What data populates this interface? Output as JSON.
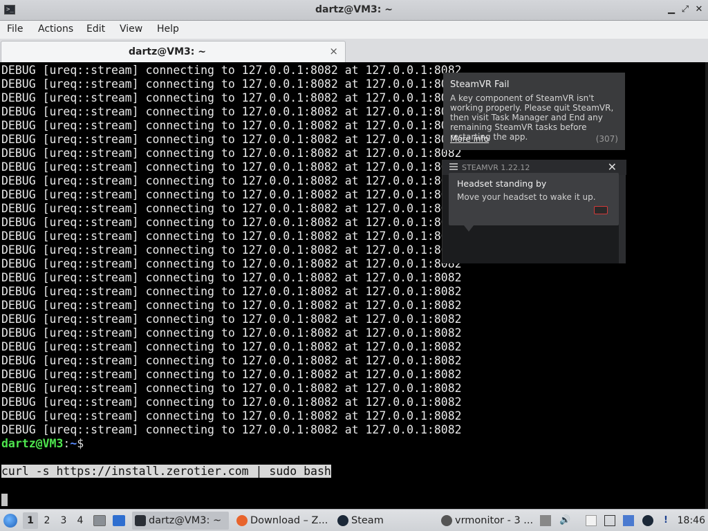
{
  "window": {
    "title": "dartz@VM3: ~",
    "controls": [
      "minimize-icon",
      "maximize-icon",
      "close-icon"
    ]
  },
  "menu": {
    "items": [
      "File",
      "Actions",
      "Edit",
      "View",
      "Help"
    ]
  },
  "tab": {
    "label": "dartz@VM3: ~",
    "close_glyph": "×"
  },
  "terminal": {
    "debug_lines": [
      "DEBUG [ureq::stream] connecting to 127.0.0.1:8082 at 127.0.0.1:8082",
      "DEBUG [ureq::stream] connecting to 127.0.0.1:8082 at 127.0.0.1:8082",
      "DEBUG [ureq::stream] connecting to 127.0.0.1:8082 at 127.0.0.1:8082",
      "DEBUG [ureq::stream] connecting to 127.0.0.1:8082 at 127.0.0.1:8082",
      "DEBUG [ureq::stream] connecting to 127.0.0.1:8082 at 127.0.0.1:8082",
      "DEBUG [ureq::stream] connecting to 127.0.0.1:8082 at 127.0.0.1:8082",
      "DEBUG [ureq::stream] connecting to 127.0.0.1:8082 at 127.0.0.1:8082",
      "DEBUG [ureq::stream] connecting to 127.0.0.1:8082 at 127.0.0.1:8082",
      "DEBUG [ureq::stream] connecting to 127.0.0.1:8082 at 127.0.0.1:8082",
      "DEBUG [ureq::stream] connecting to 127.0.0.1:8082 at 127.0.0.1:8082",
      "DEBUG [ureq::stream] connecting to 127.0.0.1:8082 at 127.0.0.1:8082",
      "DEBUG [ureq::stream] connecting to 127.0.0.1:8082 at 127.0.0.1:8082",
      "DEBUG [ureq::stream] connecting to 127.0.0.1:8082 at 127.0.0.1:8082",
      "DEBUG [ureq::stream] connecting to 127.0.0.1:8082 at 127.0.0.1:8082",
      "DEBUG [ureq::stream] connecting to 127.0.0.1:8082 at 127.0.0.1:8082",
      "DEBUG [ureq::stream] connecting to 127.0.0.1:8082 at 127.0.0.1:8082",
      "DEBUG [ureq::stream] connecting to 127.0.0.1:8082 at 127.0.0.1:8082",
      "DEBUG [ureq::stream] connecting to 127.0.0.1:8082 at 127.0.0.1:8082",
      "DEBUG [ureq::stream] connecting to 127.0.0.1:8082 at 127.0.0.1:8082",
      "DEBUG [ureq::stream] connecting to 127.0.0.1:8082 at 127.0.0.1:8082",
      "DEBUG [ureq::stream] connecting to 127.0.0.1:8082 at 127.0.0.1:8082",
      "DEBUG [ureq::stream] connecting to 127.0.0.1:8082 at 127.0.0.1:8082",
      "DEBUG [ureq::stream] connecting to 127.0.0.1:8082 at 127.0.0.1:8082",
      "DEBUG [ureq::stream] connecting to 127.0.0.1:8082 at 127.0.0.1:8082",
      "DEBUG [ureq::stream] connecting to 127.0.0.1:8082 at 127.0.0.1:8082",
      "DEBUG [ureq::stream] connecting to 127.0.0.1:8082 at 127.0.0.1:8082",
      "DEBUG [ureq::stream] connecting to 127.0.0.1:8082 at 127.0.0.1:8082"
    ],
    "prompt": {
      "user": "dartz@VM3",
      "separator": ":",
      "path": "~",
      "symbol": "$"
    },
    "selected_command": "curl -s https://install.zerotier.com | sudo bash"
  },
  "steamvr_notification": {
    "title": "SteamVR Fail",
    "body": "A key component of SteamVR isn't working properly. Please quit SteamVR, then visit Task Manager and End any remaining SteamVR tasks before restarting the app.",
    "link": "More info",
    "code": "(307)"
  },
  "steamvr_window": {
    "title": "STEAMVR 1.22.12",
    "close_glyph": "✕"
  },
  "headset_tooltip": {
    "title": "Headset standing by",
    "body": "Move your headset to wake it up."
  },
  "taskbar": {
    "workspaces": [
      "1",
      "2",
      "3",
      "4"
    ],
    "active_workspace": "1",
    "tasks": [
      {
        "label": "dartz@VM3: ~",
        "icon": "terminal-icon",
        "active": true
      },
      {
        "label": "Download – Z...",
        "icon": "firefox-icon",
        "active": false
      },
      {
        "label": "Steam",
        "icon": "steam-icon",
        "active": false
      },
      {
        "label": "vrmonitor - 3 ...",
        "icon": "vr-icon",
        "active": false
      }
    ],
    "clock": "18:46",
    "colors": {
      "accent": "#1d5fb8",
      "firefox": "#e8642c",
      "steam": "#1b2838"
    }
  }
}
